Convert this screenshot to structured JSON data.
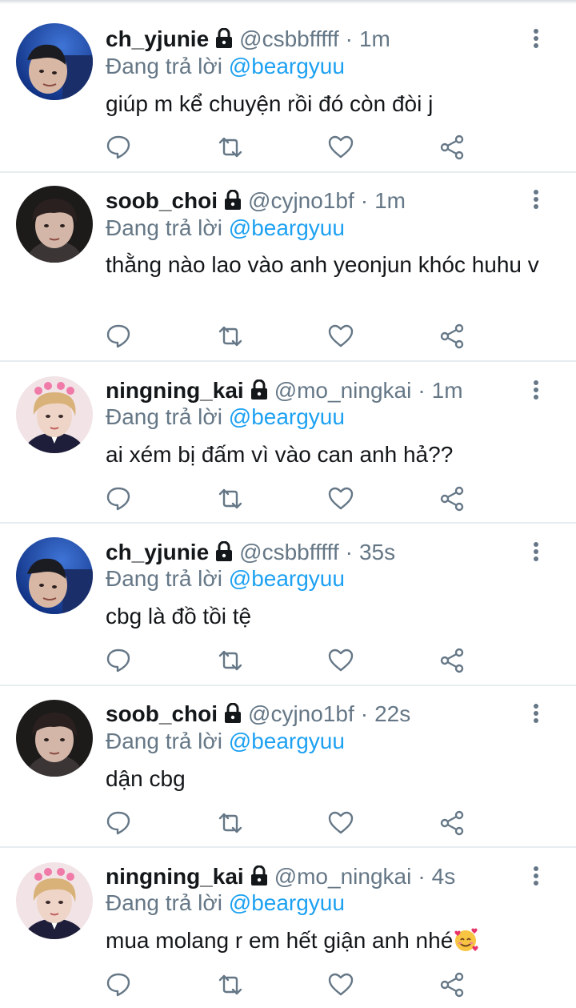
{
  "colors": {
    "text": "#14171a",
    "muted": "#657786",
    "accent": "#1da1f2",
    "divider": "#e6ecf0"
  },
  "icons": {
    "protected": "lock-icon",
    "more": "more-vertical-icon",
    "actions": [
      "reply-icon",
      "retweet-icon",
      "like-icon",
      "share-icon"
    ]
  },
  "tweets": [
    {
      "display_name": "ch_yjunie",
      "handle": "@csbbfffff",
      "separator": "·",
      "time": "1m",
      "reply_prefix": "Đang trả lời",
      "reply_to": "@beargyuu",
      "text": "giúp m kể chuyện rồi đó còn đòi j"
    },
    {
      "display_name": "soob_choi",
      "handle": "@cyjno1bf",
      "separator": "·",
      "time": "1m",
      "reply_prefix": "Đang trả lời",
      "reply_to": "@beargyuu",
      "text": "thằng nào lao vào anh yeonjun khóc huhu v"
    },
    {
      "display_name": "ningning_kai",
      "handle": "@mo_ningkai",
      "separator": "·",
      "time": "1m",
      "reply_prefix": "Đang trả lời",
      "reply_to": "@beargyuu",
      "text": "ai xém bị đấm vì vào can anh hả??"
    },
    {
      "display_name": "ch_yjunie",
      "handle": "@csbbfffff",
      "separator": "·",
      "time": "35s",
      "reply_prefix": "Đang trả lời",
      "reply_to": "@beargyuu",
      "text": "cbg là đồ tồi tệ"
    },
    {
      "display_name": "soob_choi",
      "handle": "@cyjno1bf",
      "separator": "·",
      "time": "22s",
      "reply_prefix": "Đang trả lời",
      "reply_to": "@beargyuu",
      "text": "dận cbg"
    },
    {
      "display_name": "ningning_kai",
      "handle": "@mo_ningkai",
      "separator": "·",
      "time": "4s",
      "reply_prefix": "Đang trả lời",
      "reply_to": "@beargyuu",
      "text": "mua molang r em hết giận anh nhé",
      "emoji": "smiling-face-with-hearts-emoji"
    }
  ]
}
